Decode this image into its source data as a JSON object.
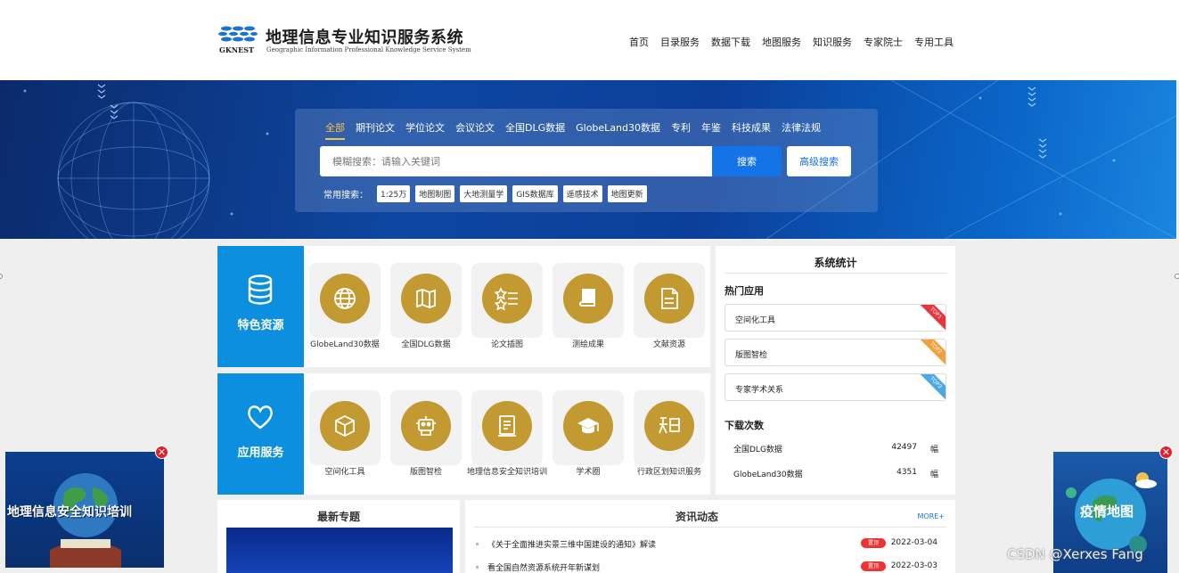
{
  "header": {
    "logo_mark_text": "GKNEST",
    "title": "地理信息专业知识服务系统",
    "subtitle": "Geographic Information Professional Knowledge Service System",
    "nav": [
      "首页",
      "目录服务",
      "数据下载",
      "地图服务",
      "知识服务",
      "专家院士",
      "专用工具"
    ]
  },
  "search": {
    "tabs": [
      "全部",
      "期刊论文",
      "学位论文",
      "会议论文",
      "全国DLG数据",
      "GlobeLand30数据",
      "专利",
      "年鉴",
      "科技成果",
      "法律法规"
    ],
    "active_tab": "全部",
    "placeholder": "模糊搜索：请输入关键词",
    "search_button": "搜索",
    "advanced_button": "高级搜索",
    "hot_label": "常用搜索：",
    "hot_tags": [
      "1:25万",
      "地图制图",
      "大地测量学",
      "GIS数据库",
      "遥感技术",
      "地图更新"
    ]
  },
  "featured": {
    "label": "特色资源",
    "items": [
      {
        "label": "GlobeLand30数据",
        "icon": "globe-icon"
      },
      {
        "label": "全国DLG数据",
        "icon": "map-icon"
      },
      {
        "label": "论文插图",
        "icon": "star-list-icon"
      },
      {
        "label": "测绘成果",
        "icon": "book-icon"
      },
      {
        "label": "文献资源",
        "icon": "document-icon"
      }
    ]
  },
  "services": {
    "label": "应用服务",
    "items": [
      {
        "label": "空间化工具",
        "icon": "cube-icon"
      },
      {
        "label": "版图智检",
        "icon": "robot-icon"
      },
      {
        "label": "地理信息安全知识培训",
        "icon": "training-icon"
      },
      {
        "label": "学术圈",
        "icon": "graduation-cap-icon"
      },
      {
        "label": "行政区划知识服务",
        "icon": "knowledge-icon"
      }
    ]
  },
  "stats": {
    "title": "系统统计",
    "hot_apps_title": "热门应用",
    "hot_apps": [
      {
        "name": "空间化工具",
        "rank": "TOP1",
        "color": "#e8353b"
      },
      {
        "name": "版图智检",
        "rank": "TOP2",
        "color": "#f3a03c"
      },
      {
        "name": "专家学术关系",
        "rank": "TOP3",
        "color": "#4aa7e8"
      }
    ],
    "downloads_title": "下载次数",
    "downloads": [
      {
        "name": "全国DLG数据",
        "count": "42497",
        "unit": "幅"
      },
      {
        "name": "GlobeLand30数据",
        "count": "4351",
        "unit": "幅"
      }
    ]
  },
  "topics": {
    "title": "最新专题"
  },
  "news": {
    "title": "资讯动态",
    "more": "MORE+",
    "items": [
      {
        "text": "《关于全面推进实景三维中国建设的通知》解读",
        "badge": "置顶",
        "date": "2022-03-04"
      },
      {
        "text": "看全国自然资源系统开年新谋划",
        "badge": "置顶",
        "date": "2022-03-03"
      }
    ]
  },
  "float_left": {
    "text": "地理信息安全知识培训",
    "close": "✕"
  },
  "float_right": {
    "text": "疫情地图",
    "close": "✕"
  },
  "watermark": "CSDN @Xerxes Fang"
}
